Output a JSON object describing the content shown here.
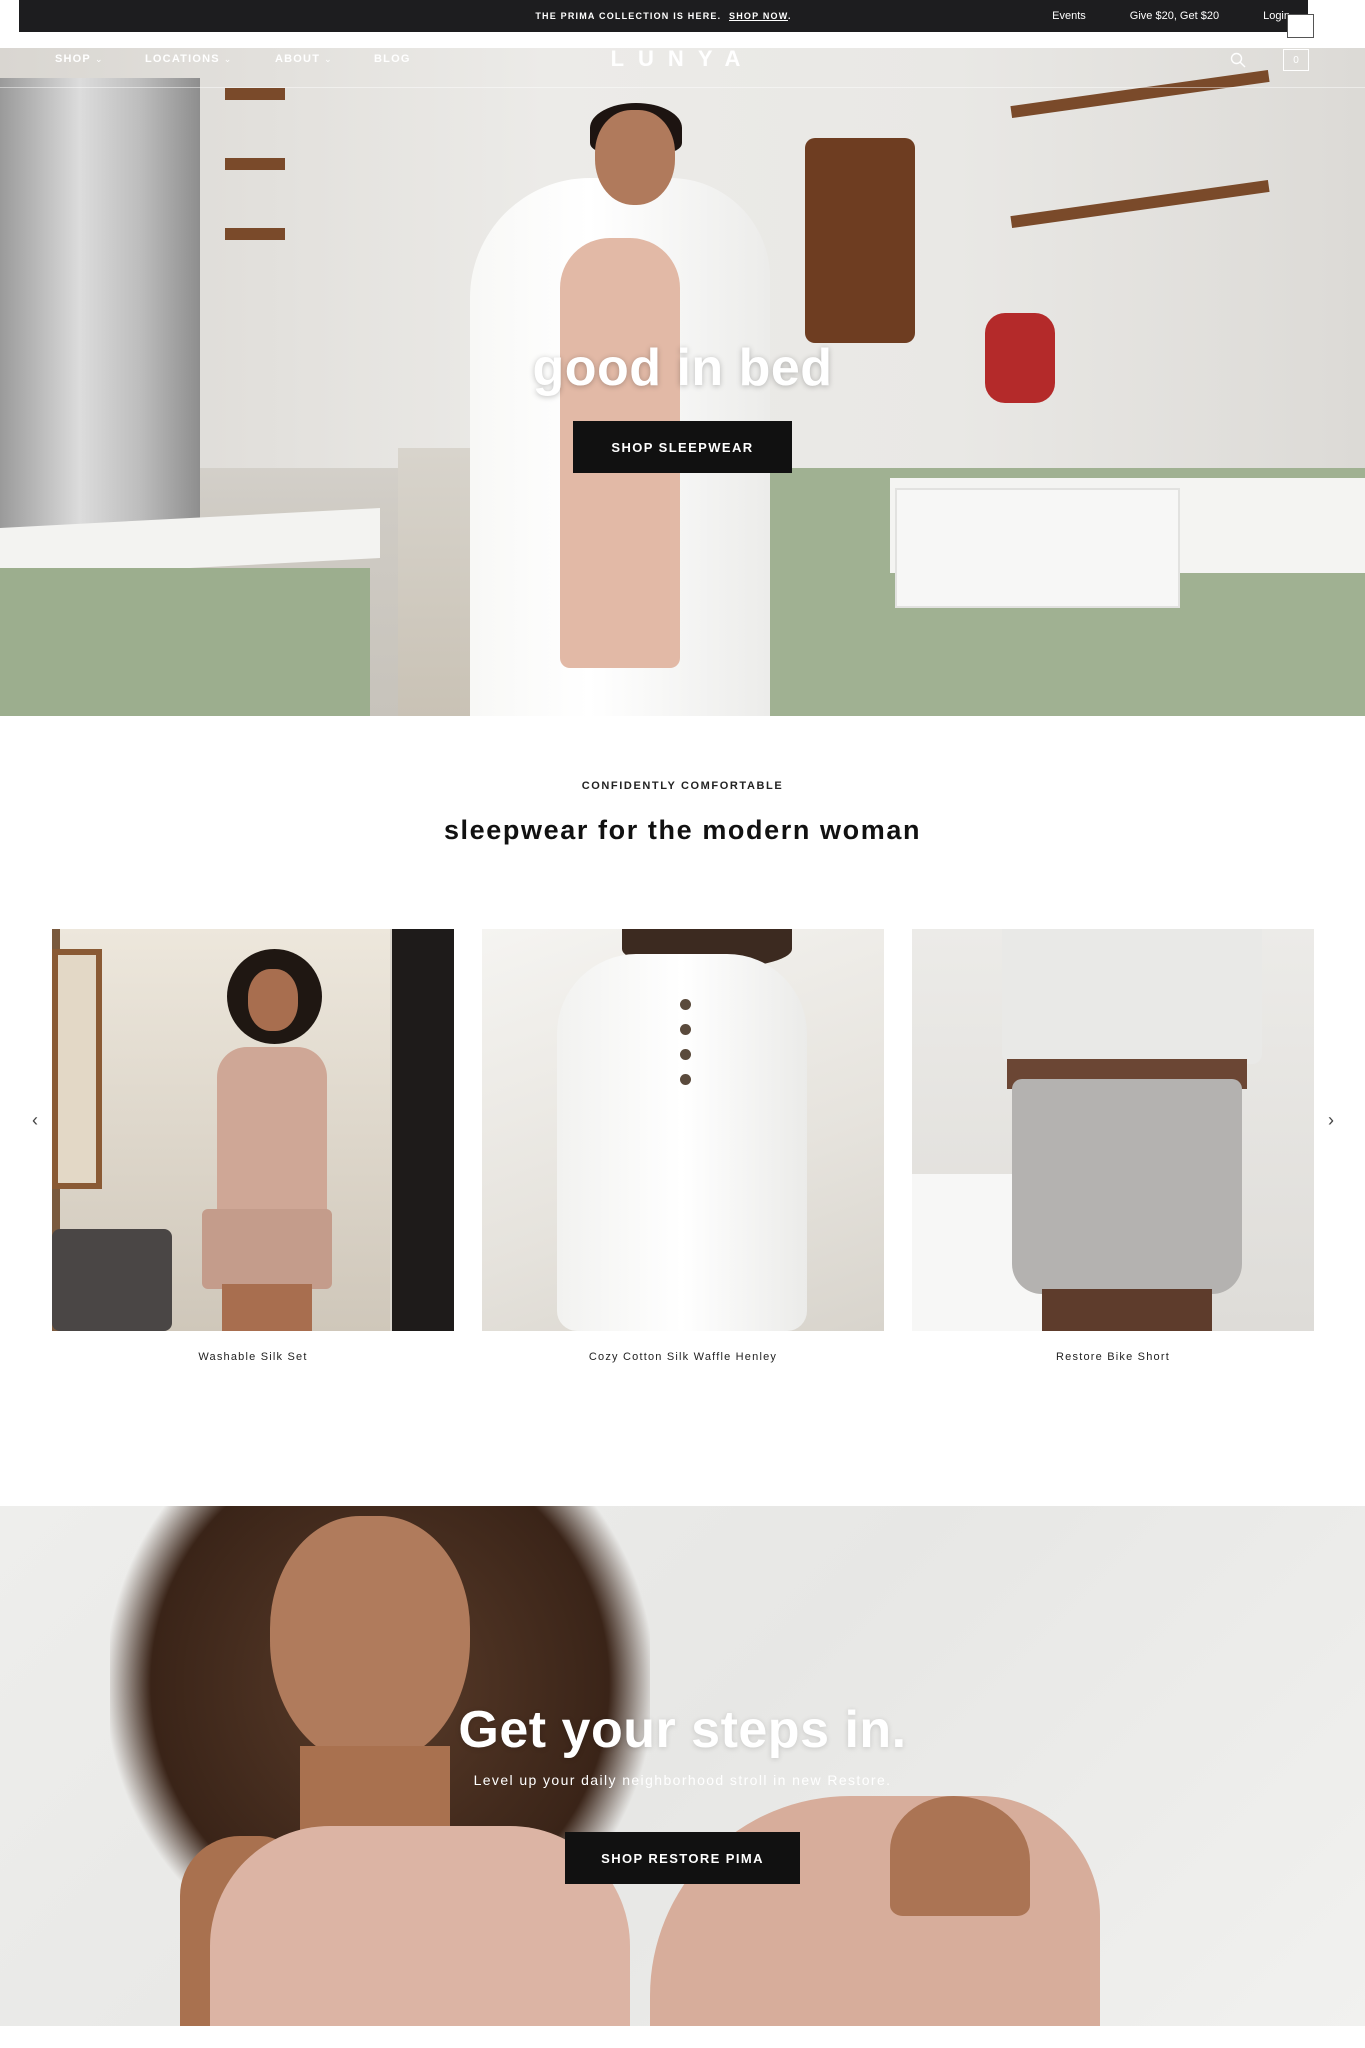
{
  "announcement": {
    "message": "THE PRIMA COLLECTION IS HERE.",
    "link_label": "SHOP NOW",
    "links": [
      "Events",
      "Give $20, Get $20",
      "Login"
    ]
  },
  "nav": {
    "items": [
      {
        "label": "SHOP",
        "has_dropdown": true
      },
      {
        "label": "LOCATIONS",
        "has_dropdown": true
      },
      {
        "label": "ABOUT",
        "has_dropdown": true
      },
      {
        "label": "BLOG",
        "has_dropdown": false
      }
    ],
    "logo": "LUNYA",
    "cart_count": "0"
  },
  "hero": {
    "title": "good in bed",
    "button_label": "SHOP SLEEPWEAR"
  },
  "intro": {
    "eyebrow": "CONFIDENTLY COMFORTABLE",
    "title": "sleepwear for the modern woman"
  },
  "products": [
    {
      "name": "Washable Silk Set"
    },
    {
      "name": "Cozy Cotton Silk Waffle Henley"
    },
    {
      "name": "Restore Bike Short"
    }
  ],
  "promo": {
    "title": "Get your steps in.",
    "subtitle": "Level up your daily neighborhood stroll in new Restore.",
    "button_label": "SHOP RESTORE PIMA"
  },
  "colors": {
    "announcement_bg": "#1d1d1f",
    "button_bg": "#111111",
    "text_light": "#ffffff"
  },
  "icons": {
    "search": "search-icon",
    "prev": "chevron-left-icon",
    "next": "chevron-right-icon",
    "dropdown": "chevron-down-icon"
  }
}
